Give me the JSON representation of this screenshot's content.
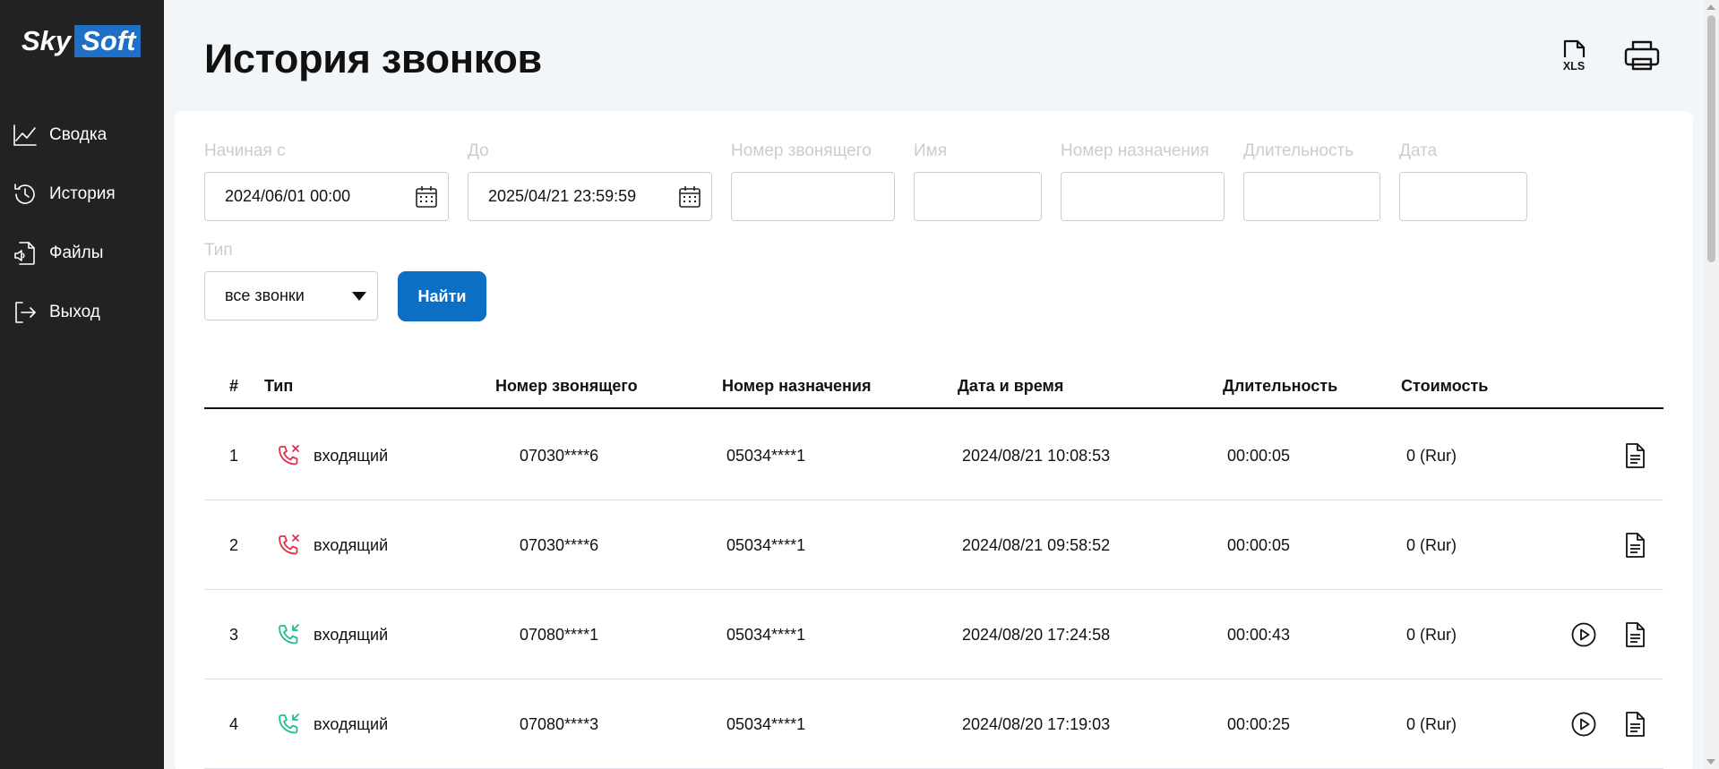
{
  "app": {
    "logo_part1": "Sky",
    "logo_part2": "Soft"
  },
  "sidebar": {
    "items": [
      {
        "label": "Сводка",
        "icon": "chart-line-icon"
      },
      {
        "label": "История",
        "icon": "history-icon"
      },
      {
        "label": "Файлы",
        "icon": "audio-file-icon"
      },
      {
        "label": "Выход",
        "icon": "logout-icon"
      }
    ]
  },
  "header": {
    "title": "История звонков",
    "xls_label": "XLS"
  },
  "filters": {
    "from_label": "Начиная с",
    "from_value": "2024/06/01 00:00",
    "to_label": "До",
    "to_value": "2025/04/21 23:59:59",
    "caller_label": "Номер звонящего",
    "caller_value": "",
    "name_label": "Имя",
    "name_value": "",
    "dest_label": "Номер назначения",
    "dest_value": "",
    "duration_label": "Длительность",
    "duration_value": "",
    "date_label": "Дата",
    "date_value": "",
    "type_label": "Тип",
    "type_value": "все звонки",
    "search_button": "Найти"
  },
  "table": {
    "columns": [
      "#",
      "Тип",
      "Номер звонящего",
      "Номер назначения",
      "Дата и время",
      "Длительность",
      "Стоимость"
    ],
    "rows": [
      {
        "n": "1",
        "status": "missed",
        "type": "входящий",
        "caller": "07030****6",
        "dest": "05034****1",
        "datetime": "2024/08/21 10:08:53",
        "duration": "00:00:05",
        "cost": "0 (Rur)",
        "has_recording": false
      },
      {
        "n": "2",
        "status": "missed",
        "type": "входящий",
        "caller": "07030****6",
        "dest": "05034****1",
        "datetime": "2024/08/21 09:58:52",
        "duration": "00:00:05",
        "cost": "0 (Rur)",
        "has_recording": false
      },
      {
        "n": "3",
        "status": "answered",
        "type": "входящий",
        "caller": "07080****1",
        "dest": "05034****1",
        "datetime": "2024/08/20 17:24:58",
        "duration": "00:00:43",
        "cost": "0 (Rur)",
        "has_recording": true
      },
      {
        "n": "4",
        "status": "answered",
        "type": "входящий",
        "caller": "07080****3",
        "dest": "05034****1",
        "datetime": "2024/08/20 17:19:03",
        "duration": "00:00:25",
        "cost": "0 (Rur)",
        "has_recording": true
      }
    ]
  },
  "colors": {
    "sidebar_bg": "#222222",
    "accent": "#0d6fc4",
    "missed": "#e0304a",
    "answered": "#1fbf93"
  }
}
